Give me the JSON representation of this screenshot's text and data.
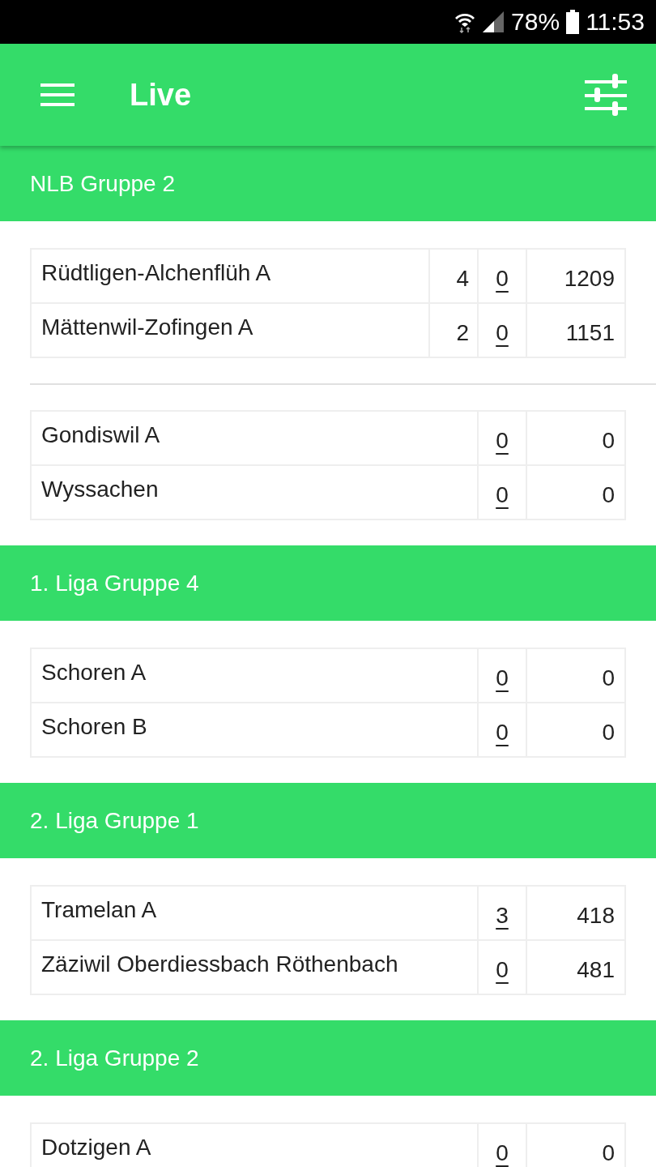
{
  "status_bar": {
    "battery": "78%",
    "time": "11:53"
  },
  "app_bar": {
    "title": "Live"
  },
  "groups": [
    {
      "title": "NLB Gruppe 2",
      "matches": [
        {
          "rows": [
            {
              "team": "Rüdtligen-Alchenflüh A",
              "column_2": "4",
              "column_3": "0",
              "column_4": "1209"
            },
            {
              "team": "Mättenwil-Zofingen A",
              "column_2": "2",
              "column_3": "0",
              "column_4": "1151"
            }
          ]
        },
        {
          "rows": [
            {
              "team": "Gondiswil A",
              "column_3": "0",
              "column_4": "0"
            },
            {
              "team": "Wyssachen",
              "column_3": "0",
              "column_4": "0"
            }
          ]
        }
      ]
    },
    {
      "title": "1. Liga Gruppe 4",
      "matches": [
        {
          "rows": [
            {
              "team": "Schoren A",
              "column_3": "0",
              "column_4": "0"
            },
            {
              "team": "Schoren B",
              "column_3": "0",
              "column_4": "0"
            }
          ]
        }
      ]
    },
    {
      "title": "2. Liga Gruppe 1",
      "matches": [
        {
          "rows": [
            {
              "team": "Tramelan A",
              "column_3": "3",
              "column_4": "418"
            },
            {
              "team": "Zäziwil Oberdiessbach Röthenbach",
              "column_3": "0",
              "column_4": "481"
            }
          ]
        }
      ]
    },
    {
      "title": "2. Liga Gruppe 2",
      "matches": [
        {
          "rows": [
            {
              "team": "Dotzigen A",
              "column_3": "0",
              "column_4": "0"
            }
          ]
        }
      ]
    }
  ]
}
